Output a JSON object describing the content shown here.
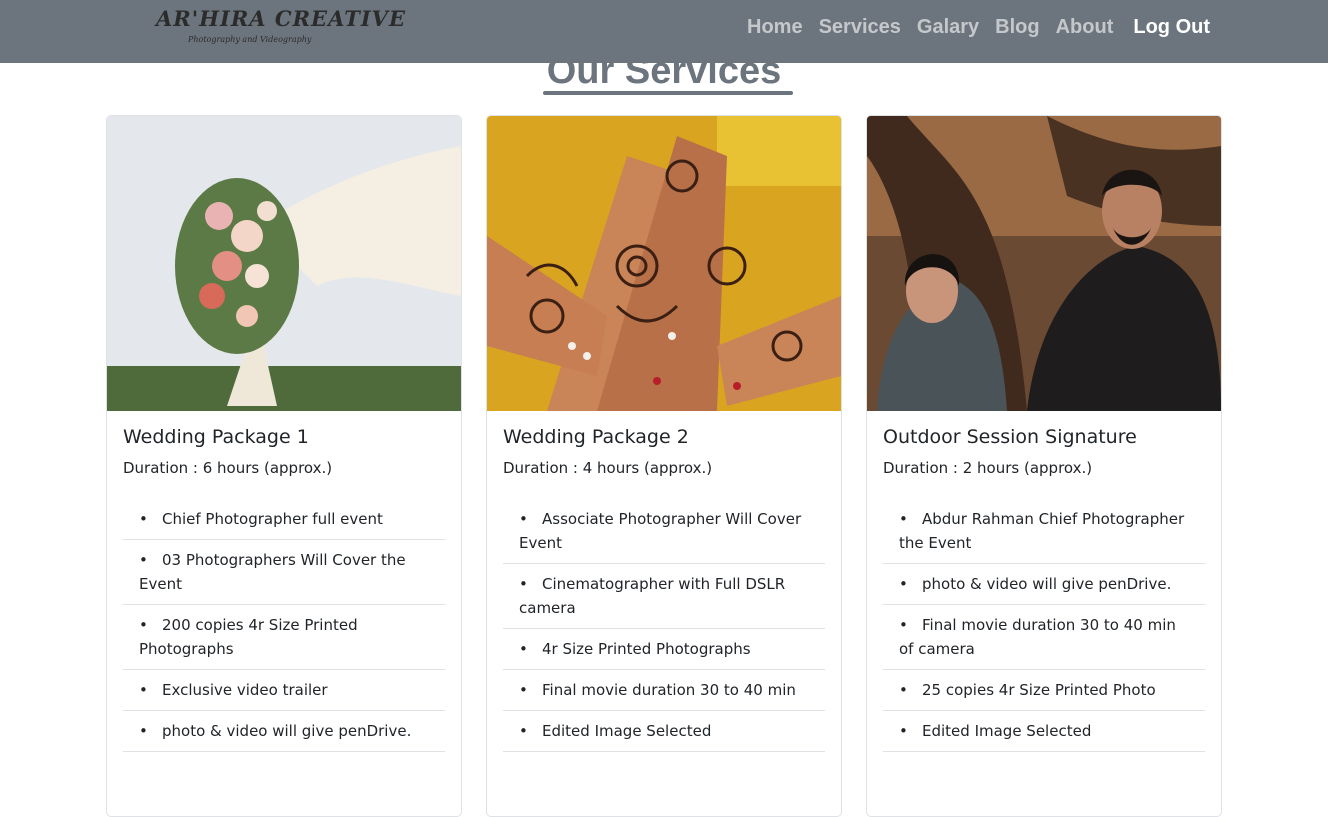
{
  "brand": {
    "name": "AR'HIRA CREATIVE",
    "tagline": "Photography and Videography"
  },
  "nav": [
    {
      "label": "Home"
    },
    {
      "label": "Services"
    },
    {
      "label": "Galary"
    },
    {
      "label": "Blog"
    },
    {
      "label": "About"
    },
    {
      "label": "Log Out"
    }
  ],
  "section": {
    "title": "Our Services"
  },
  "cards": [
    {
      "title": "Wedding Package 1",
      "duration": "Duration : 6 hours (approx.)",
      "features": [
        "Chief Photographer full event",
        "03 Photographers Will Cover the Event",
        "200 copies 4r Size Printed Photographs",
        "Exclusive video trailer",
        "photo & video will give penDrive."
      ]
    },
    {
      "title": "Wedding Package 2",
      "duration": "Duration : 4 hours (approx.)",
      "features": [
        "Associate Photographer Will Cover Event",
        "Cinematographer with Full DSLR camera",
        "4r Size Printed Photographs",
        "Final movie duration 30 to 40 min",
        "Edited Image Selected"
      ]
    },
    {
      "title": "Outdoor Session Signature",
      "duration": "Duration : 2 hours (approx.)",
      "features": [
        "Abdur Rahman Chief Photographer the Event",
        "photo & video will give penDrive.",
        "Final movie duration 30 to 40 min of camera",
        "25 copies 4r Size Printed Photo",
        "Edited Image Selected"
      ]
    }
  ],
  "colors": {
    "navbar": "#6c757d",
    "nav_link": "#d4d7da",
    "nav_active": "#ffffff",
    "heading": "#6c757d"
  }
}
